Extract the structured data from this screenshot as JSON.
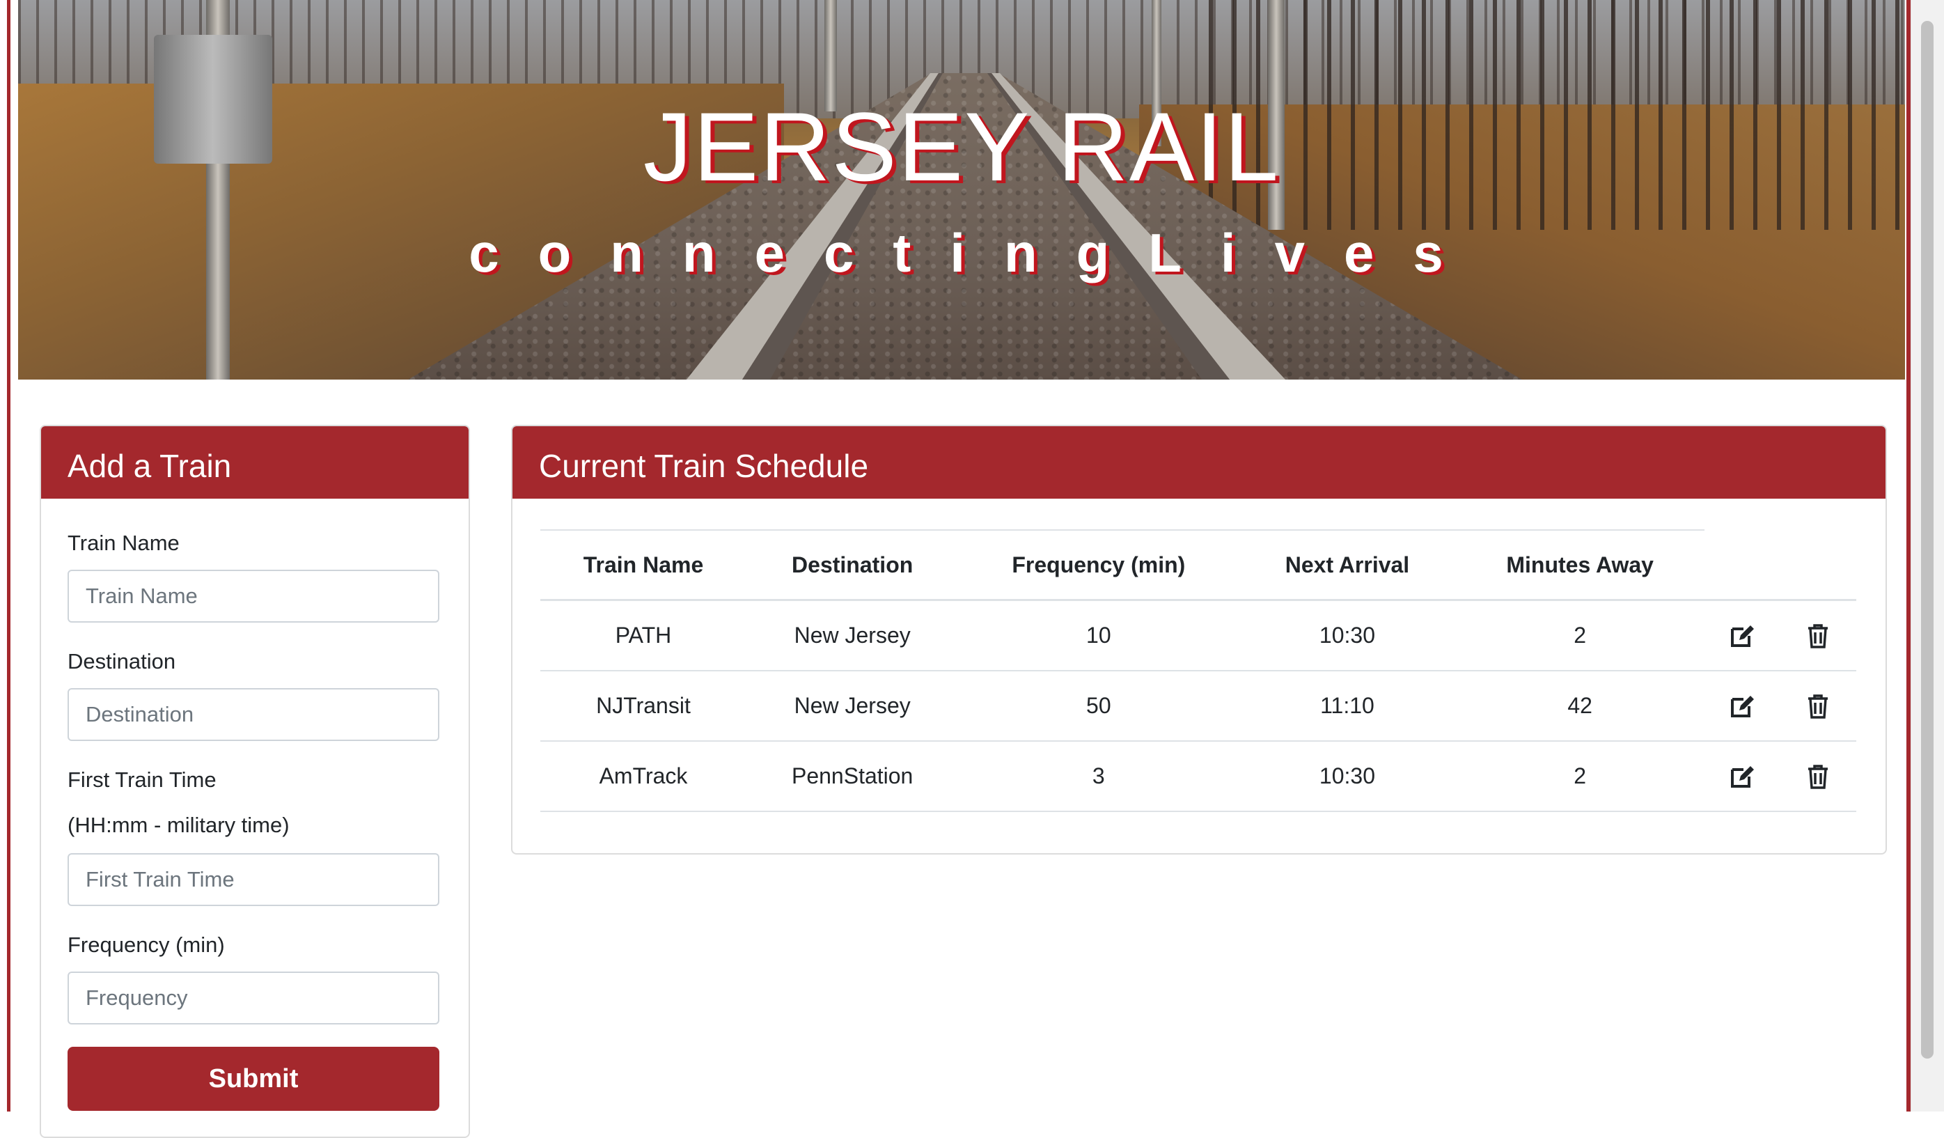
{
  "hero": {
    "title": "JERSEY RAIL",
    "subtitle": "connectingLives"
  },
  "add_train": {
    "header": "Add a Train",
    "train_name_label": "Train Name",
    "train_name_placeholder": "Train Name",
    "destination_label": "Destination",
    "destination_placeholder": "Destination",
    "first_time_label": "First Train Time",
    "first_time_hint": "(HH:mm - military time)",
    "first_time_placeholder": "First Train Time",
    "frequency_label": "Frequency (min)",
    "frequency_placeholder": "Frequency",
    "submit_label": "Submit"
  },
  "schedule": {
    "header": "Current Train Schedule",
    "columns": [
      "Train Name",
      "Destination",
      "Frequency (min)",
      "Next Arrival",
      "Minutes Away"
    ],
    "rows": [
      {
        "name": "PATH",
        "destination": "New Jersey",
        "frequency": "10",
        "next_arrival": "10:30",
        "minutes_away": "2"
      },
      {
        "name": "NJTransit",
        "destination": "New Jersey",
        "frequency": "50",
        "next_arrival": "11:10",
        "minutes_away": "42"
      },
      {
        "name": "AmTrack",
        "destination": "PennStation",
        "frequency": "3",
        "next_arrival": "10:30",
        "minutes_away": "2"
      }
    ]
  },
  "icons": {
    "row_actions": [
      "edit-icon",
      "trash-icon"
    ]
  },
  "colors": {
    "brand_red": "#a4282d",
    "title_shadow": "#c0161e"
  }
}
